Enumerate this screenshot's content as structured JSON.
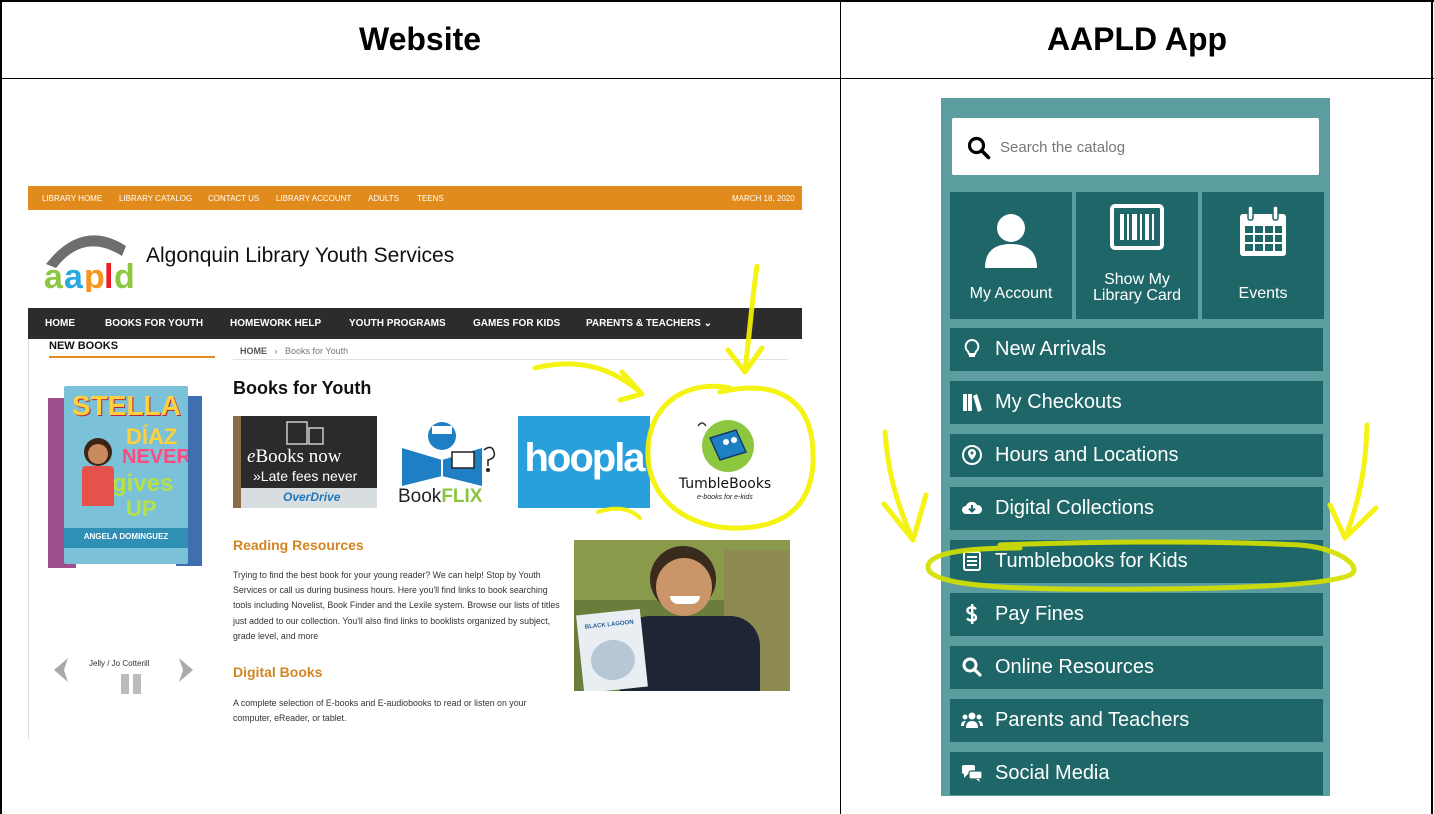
{
  "headers": {
    "left": "Website",
    "right": "AAPLD App"
  },
  "website": {
    "topbar": {
      "items": [
        "LIBRARY HOME",
        "LIBRARY CATALOG",
        "CONTACT US",
        "LIBRARY ACCOUNT",
        "ADULTS",
        "TEENS"
      ],
      "date": "MARCH 18, 2020"
    },
    "logo_text": "aapld",
    "title": "Algonquin Library Youth Services",
    "nav": [
      "HOME",
      "BOOKS FOR YOUTH",
      "HOMEWORK HELP",
      "YOUTH PROGRAMS",
      "GAMES FOR KIDS",
      "PARENTS & TEACHERS ⌄"
    ],
    "sidebar_heading": "NEW BOOKS",
    "breadcrumb": {
      "home": "HOME",
      "sep": "›",
      "current": "Books for Youth"
    },
    "page_heading": "Books for Youth",
    "book_cover": {
      "title1": "STELLA",
      "title2": "DÍAZ",
      "title3": "NEVER",
      "title4": "gives",
      "title5": "UP",
      "author": "ANGELA DOMINGUEZ"
    },
    "carousel_caption": "Jelly / Jo Cotterill",
    "tiles": {
      "overdrive": {
        "line1a": "e",
        "line1b": "Books now",
        "line2": "»Late fees never",
        "brand": "OverDrive"
      },
      "bookflix": {
        "a": "Book",
        "b": "FLIX"
      },
      "hoopla": "hoopla",
      "tumblebooks": {
        "name": "TumbleBooks",
        "tag": "e-books for e-kids"
      }
    },
    "reading_resources": {
      "heading": "Reading Resources",
      "text": "Trying to find the best book for your young reader? We can help! Stop by Youth Services or call us during business hours. Here you'll find links to book searching tools including Novelist, Book Finder and the Lexile system. Browse our lists of titles just added to our collection. You'll also find links to booklists organized by subject, grade level, and more"
    },
    "digital_books": {
      "heading": "Digital Books",
      "text": "A complete selection of E-books and E-audiobooks to read or listen on your computer, eReader, or tablet."
    },
    "photo_book_title": "BLACK LAGOON"
  },
  "app": {
    "search_placeholder": "Search the catalog",
    "tiles": [
      {
        "label": "My Account",
        "icon": "person-icon"
      },
      {
        "label1": "Show My",
        "label2": "Library Card",
        "icon": "barcode-icon"
      },
      {
        "label": "Events",
        "icon": "calendar-icon"
      }
    ],
    "menu": [
      {
        "label": "New Arrivals",
        "icon": "lightbulb-icon"
      },
      {
        "label": "My Checkouts",
        "icon": "books-icon"
      },
      {
        "label": "Hours and Locations",
        "icon": "location-icon"
      },
      {
        "label": "Digital Collections",
        "icon": "cloud-download-icon"
      },
      {
        "label": "Tumblebooks for Kids",
        "icon": "list-alt-icon"
      },
      {
        "label": "Pay Fines",
        "icon": "dollar-icon"
      },
      {
        "label": "Online Resources",
        "icon": "search-icon"
      },
      {
        "label": "Parents and Teachers",
        "icon": "users-icon"
      },
      {
        "label": "Social Media",
        "icon": "comments-icon"
      }
    ]
  },
  "colors": {
    "site_orange": "#e28b1d",
    "site_nav": "#2c2c2c",
    "app_bg": "#5c9ea0",
    "app_tile": "#1f6668",
    "highlight": "#f5f200"
  }
}
